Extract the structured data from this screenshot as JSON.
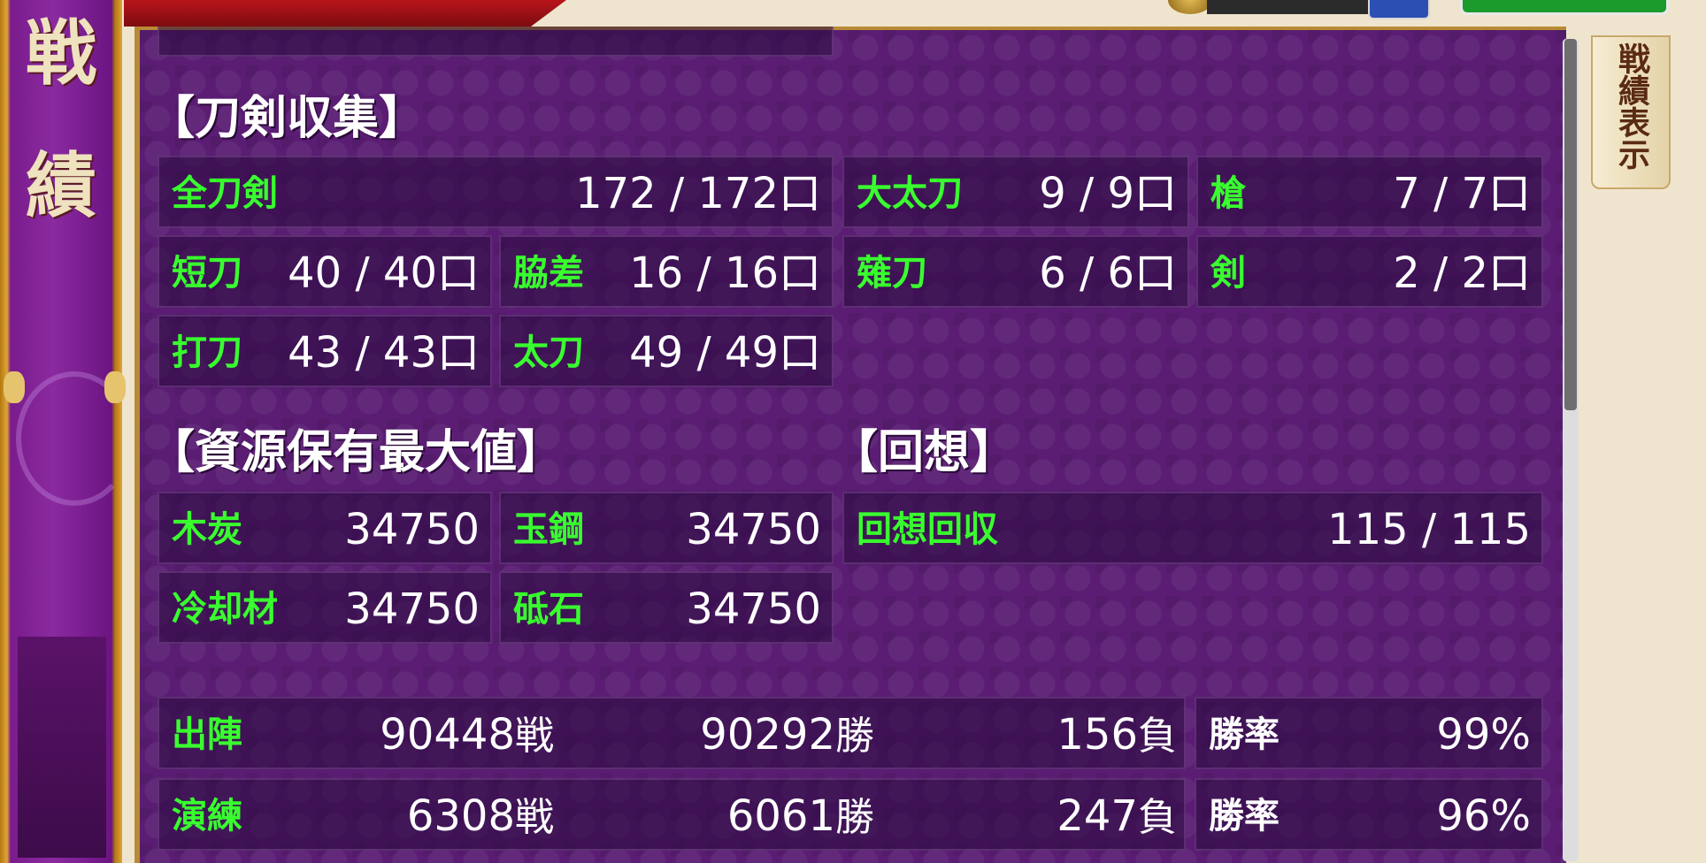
{
  "banner": {
    "char1": "戦",
    "char2": "績"
  },
  "side_tab": {
    "label": "戦績表示"
  },
  "sword_collection": {
    "title": "【刀剣収集】",
    "total": {
      "label": "全刀剣",
      "value": "172 / 172口"
    },
    "odachi": {
      "label": "大太刀",
      "value": "9 / 9口"
    },
    "yari": {
      "label": "槍",
      "value": "7 / 7口"
    },
    "tanto": {
      "label": "短刀",
      "value": "40 / 40口"
    },
    "wakizashi": {
      "label": "脇差",
      "value": "16 / 16口"
    },
    "naginata": {
      "label": "薙刀",
      "value": "6 / 6口"
    },
    "tsurugi": {
      "label": "剣",
      "value": "2 / 2口"
    },
    "uchigatana": {
      "label": "打刀",
      "value": "43 / 43口"
    },
    "tachi": {
      "label": "太刀",
      "value": "49 / 49口"
    }
  },
  "resources": {
    "title": "【資源保有最大値】",
    "charcoal": {
      "label": "木炭",
      "value": "34750"
    },
    "steel": {
      "label": "玉鋼",
      "value": "34750"
    },
    "coolant": {
      "label": "冷却材",
      "value": "34750"
    },
    "whetstone": {
      "label": "砥石",
      "value": "34750"
    }
  },
  "recollection": {
    "title": "【回想】",
    "collected": {
      "label": "回想回収",
      "value": "115 / 115"
    }
  },
  "battle": {
    "sortie": {
      "label": "出陣",
      "battles": "90448",
      "battles_unit": "戦",
      "wins": "90292",
      "wins_unit": "勝",
      "losses": "156",
      "losses_unit": "負",
      "rate_label": "勝率",
      "rate": "99%"
    },
    "practice": {
      "label": "演練",
      "battles": "6308",
      "battles_unit": "戦",
      "wins": "6061",
      "wins_unit": "勝",
      "losses": "247",
      "losses_unit": "負",
      "rate_label": "勝率",
      "rate": "96%"
    }
  }
}
